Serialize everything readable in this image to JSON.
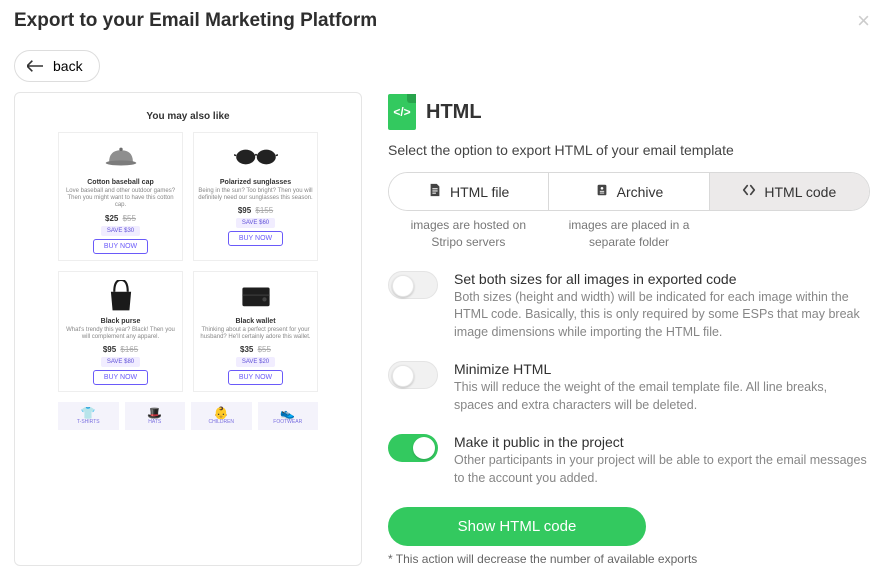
{
  "modal": {
    "title": "Export to your Email Marketing Platform",
    "close_label": "×",
    "back_label": "back"
  },
  "preview": {
    "heading": "You may also like",
    "products": [
      {
        "name": "Cotton baseball cap",
        "desc": "Love baseball and other outdoor games? Then you might want to have this cotton cap.",
        "price": "$25",
        "old": "$55",
        "badge": "SAVE $30"
      },
      {
        "name": "Polarized sunglasses",
        "desc": "Being in the sun? Too bright? Then you will definitely need our sunglasses this season.",
        "price": "$95",
        "old": "$155",
        "badge": "SAVE $60"
      },
      {
        "name": "Black purse",
        "desc": "What's trendy this year? Black! Then you will complement any apparel.",
        "price": "$95",
        "old": "$165",
        "badge": "SAVE $80"
      },
      {
        "name": "Black wallet",
        "desc": "Thinking about a perfect present for your husband? He'll certainly adore this wallet.",
        "price": "$35",
        "old": "$55",
        "badge": "SAVE $20"
      }
    ],
    "buy_label": "BUY NOW",
    "categories": [
      "T-SHIRTS",
      "HATS",
      "CHILDREN",
      "FOOTWEAR"
    ]
  },
  "export": {
    "format_name": "HTML",
    "subtitle": "Select the option to export HTML of your email template",
    "tabs": [
      {
        "label": "HTML file",
        "sub": "images are hosted on Stripo servers"
      },
      {
        "label": "Archive",
        "sub": "images are placed in a separate folder"
      },
      {
        "label": "HTML code",
        "sub": ""
      }
    ],
    "active_tab_index": 2,
    "options": [
      {
        "title": "Set both sizes for all images in exported code",
        "desc": "Both sizes (height and width) will be indicated for each image within the HTML code. Basically, this is only required by some ESPs that may break image dimensions while importing the HTML file.",
        "on": false
      },
      {
        "title": "Minimize HTML",
        "desc": "This will reduce the weight of the email template file. All line breaks, spaces and extra characters will be deleted.",
        "on": false
      },
      {
        "title": "Make it public in the project",
        "desc": "Other participants in your project will be able to export the email messages to the account you added.",
        "on": true
      }
    ],
    "cta_label": "Show HTML code",
    "footnote": "* This action will decrease the number of available exports"
  }
}
